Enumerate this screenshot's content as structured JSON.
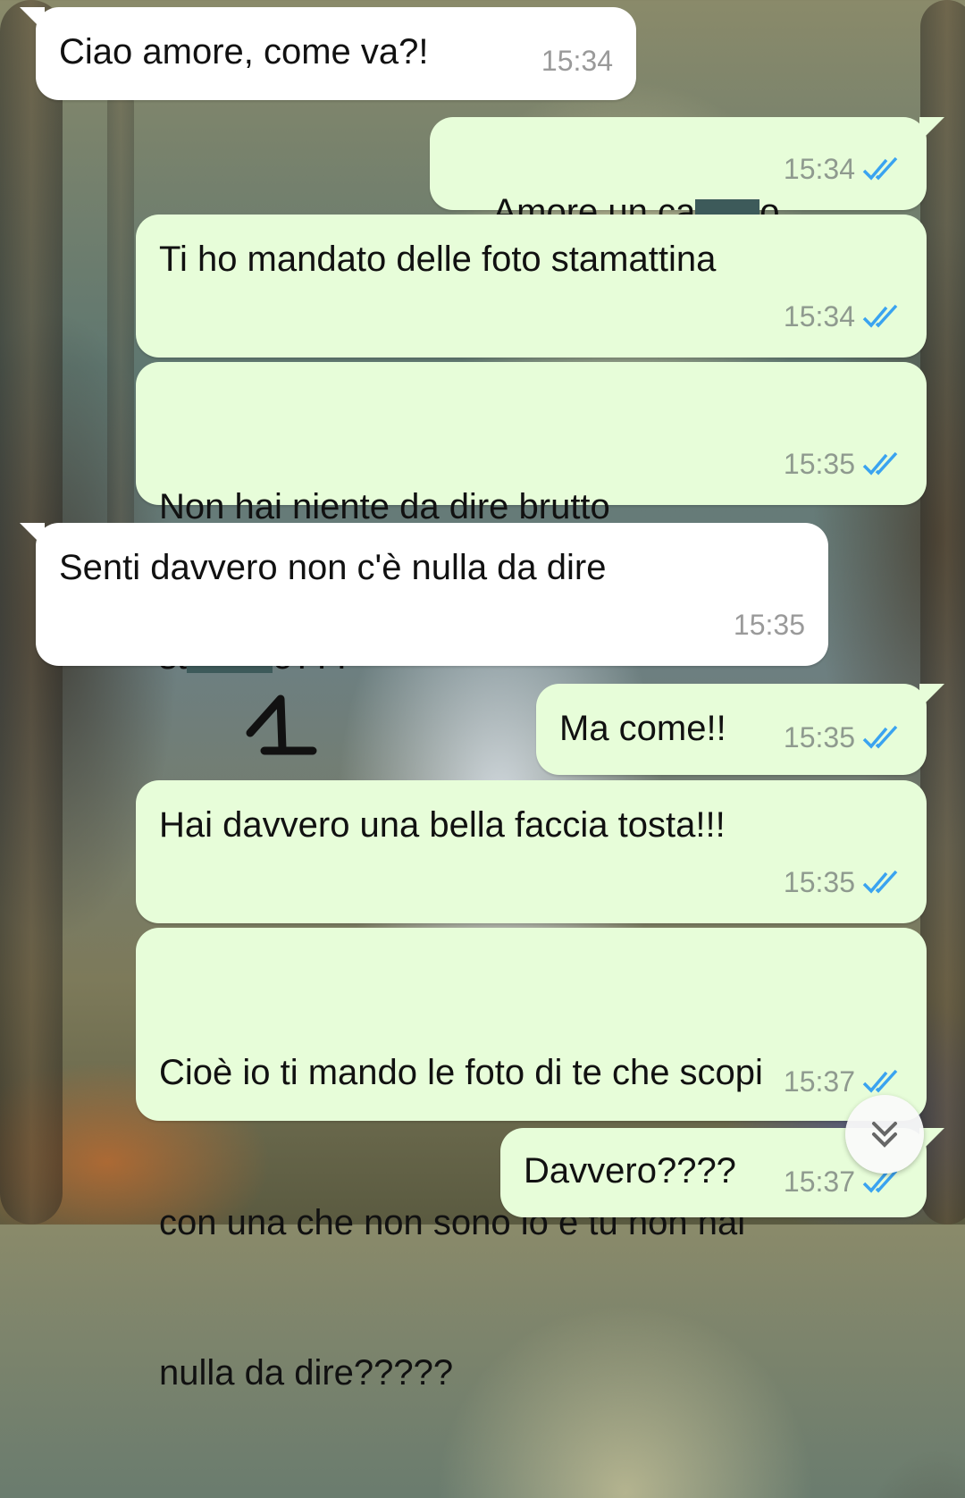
{
  "messages": [
    {
      "direction": "incoming",
      "text": "Ciao amore, come va?!",
      "time": "15:34"
    },
    {
      "direction": "outgoing",
      "text_before": "Amore un ca",
      "text_after": "o",
      "time": "15:34",
      "status": "read"
    },
    {
      "direction": "outgoing",
      "text": "Ti ho mandato delle foto stamattina",
      "time": "15:34",
      "status": "read"
    },
    {
      "direction": "outgoing",
      "line1": "Non hai niente da dire brutto",
      "line2_before": "st",
      "line2_after": "o???",
      "time": "15:35",
      "status": "read"
    },
    {
      "direction": "incoming",
      "text": "Senti davvero non c'è nulla da dire",
      "time": "15:35"
    },
    {
      "direction": "outgoing",
      "text": "Ma come!!",
      "time": "15:35",
      "status": "read"
    },
    {
      "direction": "outgoing",
      "text": "Hai davvero una bella faccia tosta!!!",
      "time": "15:35",
      "status": "read"
    },
    {
      "direction": "outgoing",
      "line1": "Cioè io ti mando le foto di te che scopi",
      "line2": "con una che non sono io e tu non hai",
      "line3": "nulla da dire?????",
      "time": "15:37",
      "status": "read"
    },
    {
      "direction": "outgoing",
      "text": "Davvero????",
      "time": "15:37",
      "status": "read"
    }
  ],
  "annotation": {
    "label": "1"
  },
  "colors": {
    "incoming_bubble": "#ffffff",
    "outgoing_bubble": "#e7fdd9",
    "read_ticks": "#3aa3f0",
    "redaction": "#3d5a5a"
  },
  "icons": {
    "scroll_down": "double-chevron-down-icon",
    "read_receipt": "double-check-icon"
  }
}
